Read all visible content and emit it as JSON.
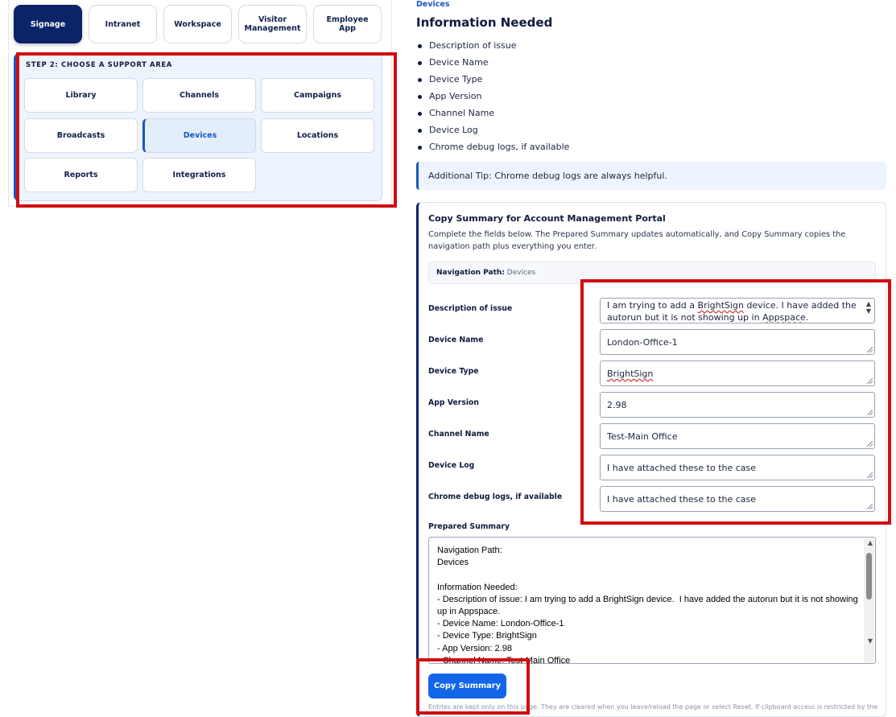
{
  "product_tabs": [
    {
      "label": "Signage",
      "active": true
    },
    {
      "label": "Intranet",
      "active": false
    },
    {
      "label": "Workspace",
      "active": false
    },
    {
      "label": "Visitor Management",
      "active": false
    },
    {
      "label": "Employee App",
      "active": false
    }
  ],
  "step2": {
    "title": "STEP 2: CHOOSE A SUPPORT AREA",
    "areas": [
      {
        "label": "Library",
        "active": false
      },
      {
        "label": "Channels",
        "active": false
      },
      {
        "label": "Campaigns",
        "active": false
      },
      {
        "label": "Broadcasts",
        "active": false
      },
      {
        "label": "Devices",
        "active": true
      },
      {
        "label": "Locations",
        "active": false
      },
      {
        "label": "Reports",
        "active": false
      },
      {
        "label": "Integrations",
        "active": false
      }
    ]
  },
  "breadcrumb": "Devices",
  "info": {
    "heading": "Information Needed",
    "items": [
      "Description of issue",
      "Device Name",
      "Device Type",
      "App Version",
      "Channel Name",
      "Device Log",
      "Chrome debug logs, if available"
    ],
    "tip": "Additional Tip: Chrome debug logs are always helpful."
  },
  "copy_card": {
    "title": "Copy Summary for Account Management Portal",
    "description": "Complete the fields below. The Prepared Summary updates automatically, and Copy Summary copies the navigation path plus everything you enter.",
    "nav_path_label": "Navigation Path:",
    "nav_path_value": "Devices",
    "fields": {
      "description": {
        "label": "Description of issue",
        "value_a": "I am trying to add a ",
        "value_b": "BrightSign",
        "value_c": " device.  I have added the autorun but it is not showing up in ",
        "value_d": "Appspace",
        "value_e": "."
      },
      "device_name": {
        "label": "Device Name",
        "value": "London-Office-1"
      },
      "device_type": {
        "label": "Device Type",
        "value": "BrightSign"
      },
      "app_version": {
        "label": "App Version",
        "value": "2.98"
      },
      "channel_name": {
        "label": "Channel Name",
        "value": "Test-Main Office"
      },
      "device_log": {
        "label": "Device Log",
        "value": " I have attached these to the case"
      },
      "chrome_logs": {
        "label": "Chrome debug logs, if available",
        "value": " I have attached these to the case"
      }
    },
    "prepared_label": "Prepared Summary",
    "prepared_text": "Navigation Path:\nDevices\n\nInformation Needed:\n- Description of issue: I am trying to add a BrightSign device.  I have added the autorun but it is not showing up in Appspace.\n- Device Name: London-Office-1\n- Device Type: BrightSign\n- App Version: 2.98\n- Channel Name: Test-Main Office",
    "copy_button": "Copy Summary",
    "footnote": "Entries are kept only on this page. They are cleared when you leave/reload the page or select Reset. If clipboard access is restricted by the"
  },
  "icons": {
    "scroll_up": "▲",
    "scroll_down": "▼"
  },
  "colors": {
    "navy": "#0a2468",
    "accent": "#1757c4",
    "button": "#1366e8",
    "highlight": "#d10d12"
  }
}
